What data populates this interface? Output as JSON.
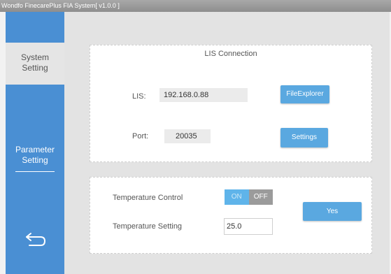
{
  "window": {
    "title": "Wondfo FinecarePlus FIA System[ v1.0.0 ]"
  },
  "sidebar": {
    "items": [
      {
        "label_line1": "System",
        "label_line2": "Setting"
      },
      {
        "label_line1": "Parameter",
        "label_line2": "Setting"
      }
    ],
    "back_icon": "back-arrow-icon"
  },
  "lis_connection": {
    "title": "LIS Connection",
    "lis_label": "LIS:",
    "lis_value": "192.168.0.88",
    "file_explorer_label": "FileExplorer",
    "port_label": "Port:",
    "port_value": "20035",
    "settings_label": "Settings"
  },
  "temperature": {
    "control_label": "Temperature Control",
    "toggle_on_label": "ON",
    "toggle_off_label": "OFF",
    "setting_label": "Temperature Setting",
    "setting_value": "25.0",
    "yes_label": "Yes"
  },
  "colors": {
    "sidebar_blue": "#4a8fd3",
    "button_blue": "#5aa8e0",
    "toggle_on": "#5fb4ea",
    "toggle_off": "#9b9b9b"
  }
}
